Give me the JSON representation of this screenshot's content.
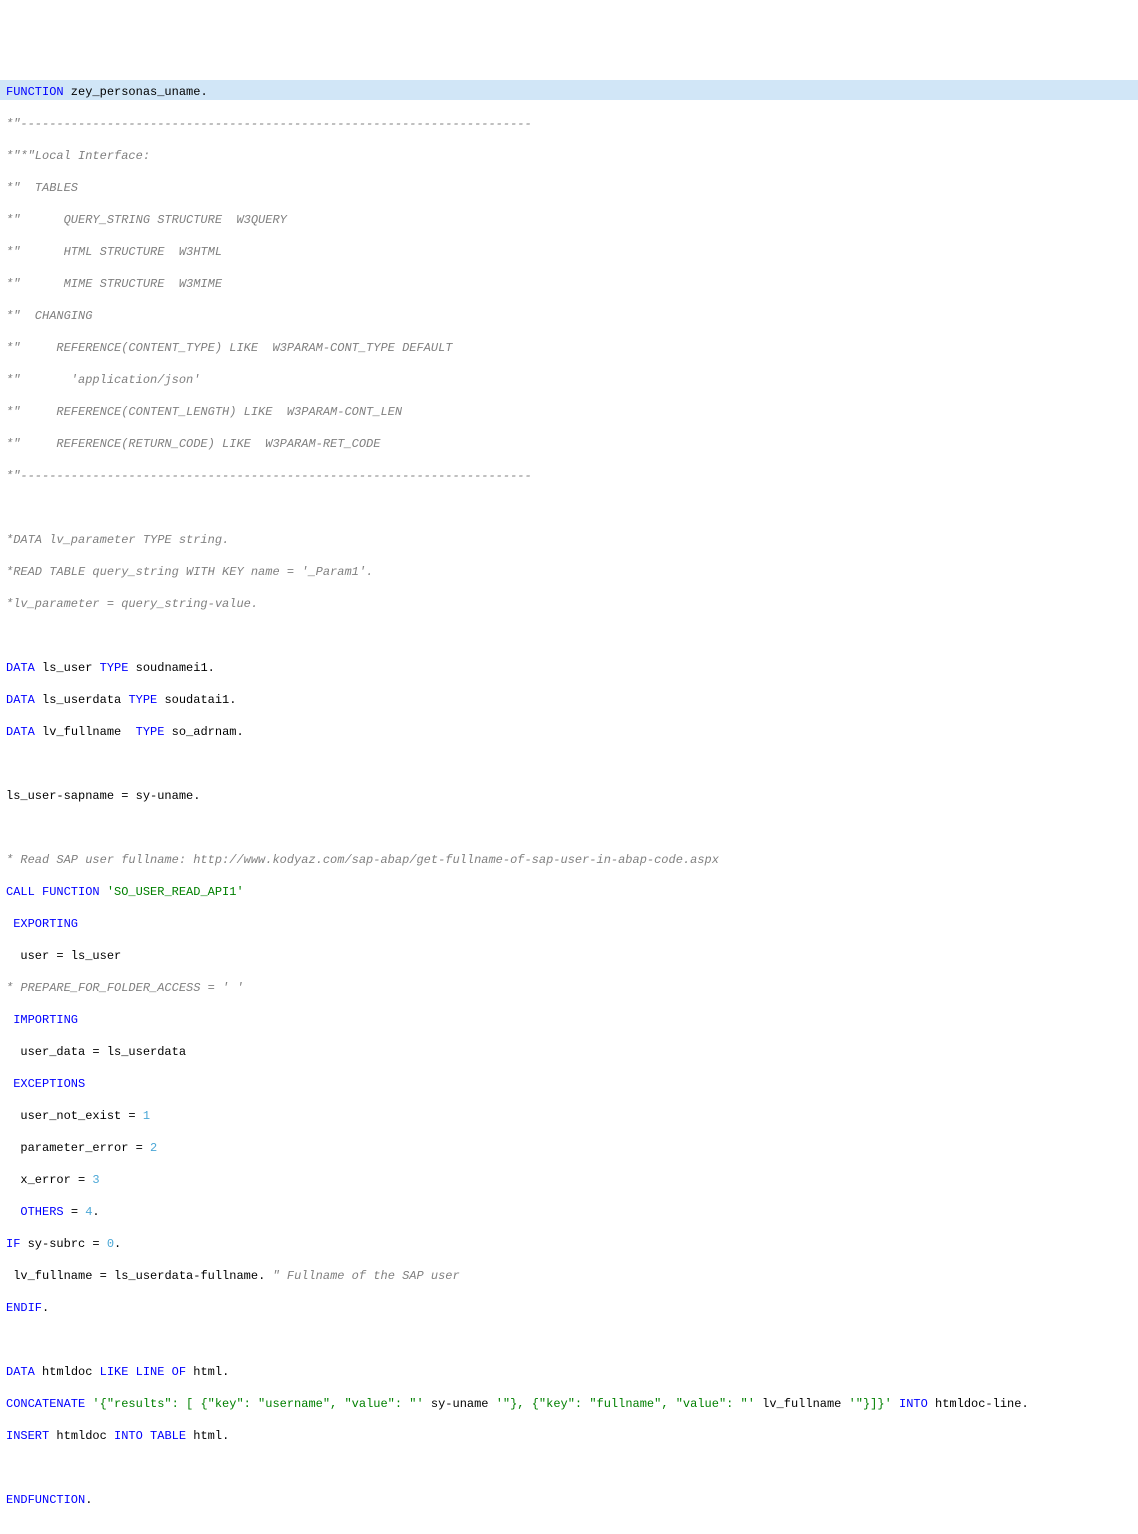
{
  "code": {
    "l1_kw": "FUNCTION",
    "l1_name": " zey_personas_uname",
    "l1_dot": ".",
    "l2": "*\"-----------------------------------------------------------------------",
    "l3": "*\"*\"Local Interface:",
    "l4": "*\"  TABLES",
    "l5": "*\"      QUERY_STRING STRUCTURE  W3QUERY",
    "l6": "*\"      HTML STRUCTURE  W3HTML",
    "l7": "*\"      MIME STRUCTURE  W3MIME",
    "l8": "*\"  CHANGING",
    "l9": "*\"     REFERENCE(CONTENT_TYPE) LIKE  W3PARAM-CONT_TYPE DEFAULT",
    "l10": "*\"       'application/json'",
    "l11": "*\"     REFERENCE(CONTENT_LENGTH) LIKE  W3PARAM-CONT_LEN",
    "l12": "*\"     REFERENCE(RETURN_CODE) LIKE  W3PARAM-RET_CODE",
    "l13": "*\"-----------------------------------------------------------------------",
    "l14": "",
    "l15": "*DATA lv_parameter TYPE string.",
    "l16": "*READ TABLE query_string WITH KEY name = '_Param1'.",
    "l17": "*lv_parameter = query_string-value.",
    "l18": "",
    "l19_data": "DATA",
    "l19_var": " ls_user ",
    "l19_type": "TYPE",
    "l19_t": " soudnamei1",
    "l20_data": "DATA",
    "l20_var": " ls_userdata ",
    "l20_type": "TYPE",
    "l20_t": " soudatai1",
    "l21_data": "DATA",
    "l21_var": " lv_fullname  ",
    "l21_type": "TYPE",
    "l21_t": " so_adrnam",
    "l22": "",
    "l23_lhs": "ls_user-sapname ",
    "l23_eq": "=",
    "l23_rhs": " sy-uname",
    "l24": "",
    "l25": "* Read SAP user fullname: http://www.kodyaz.com/sap-abap/get-fullname-of-sap-user-in-abap-code.aspx",
    "l26_call": "CALL FUNCTION ",
    "l26_fn": "'SO_USER_READ_API1'",
    "l27": " EXPORTING",
    "l28_lhs": "  user ",
    "l28_eq": "=",
    "l28_rhs": " ls_user",
    "l29": "* PREPARE_FOR_FOLDER_ACCESS = ' '",
    "l30": " IMPORTING",
    "l31_lhs": "  user_data ",
    "l31_eq": "=",
    "l31_rhs": " ls_userdata",
    "l32": " EXCEPTIONS",
    "l33_lhs": "  user_not_exist ",
    "l33_eq": "=",
    "l33_n": " 1",
    "l34_lhs": "  parameter_error ",
    "l34_eq": "=",
    "l34_n": " 2",
    "l35_lhs": "  x_error ",
    "l35_eq": "=",
    "l35_n": " 3",
    "l36_kw": "  OTHERS ",
    "l36_eq": "=",
    "l36_n": " 4",
    "l37_if": "IF",
    "l37_var": " sy-subrc ",
    "l37_eq": "=",
    "l37_n": " 0",
    "l38_lhs": " lv_fullname ",
    "l38_eq": "=",
    "l38_rhs": " ls_userdata-fullname",
    "l38_dot": ". ",
    "l38_cm": "\" Fullname of the SAP user",
    "l39": "ENDIF",
    "l40": "",
    "l41_data": "DATA",
    "l41_var": " htmldoc ",
    "l41_like": "LIKE LINE OF",
    "l41_t": " html",
    "l42_kw": "CONCATENATE ",
    "l42_s1": "'{\"results\": [ {\"key\": \"username\", \"value\": \"'",
    "l42_v1": " sy-uname ",
    "l42_s2": "'\"}, {\"key\": \"fullname\", \"value\": \"'",
    "l42_v2": " lv_fullname ",
    "l42_s3": "'\"}]}'",
    "l42_into": " INTO",
    "l42_tgt": " htmldoc-line",
    "l43_kw1": "INSERT",
    "l43_v": " htmldoc ",
    "l43_kw2": "INTO TABLE",
    "l43_t": " html",
    "l44": "",
    "l45": "ENDFUNCTION",
    "dot": "."
  }
}
